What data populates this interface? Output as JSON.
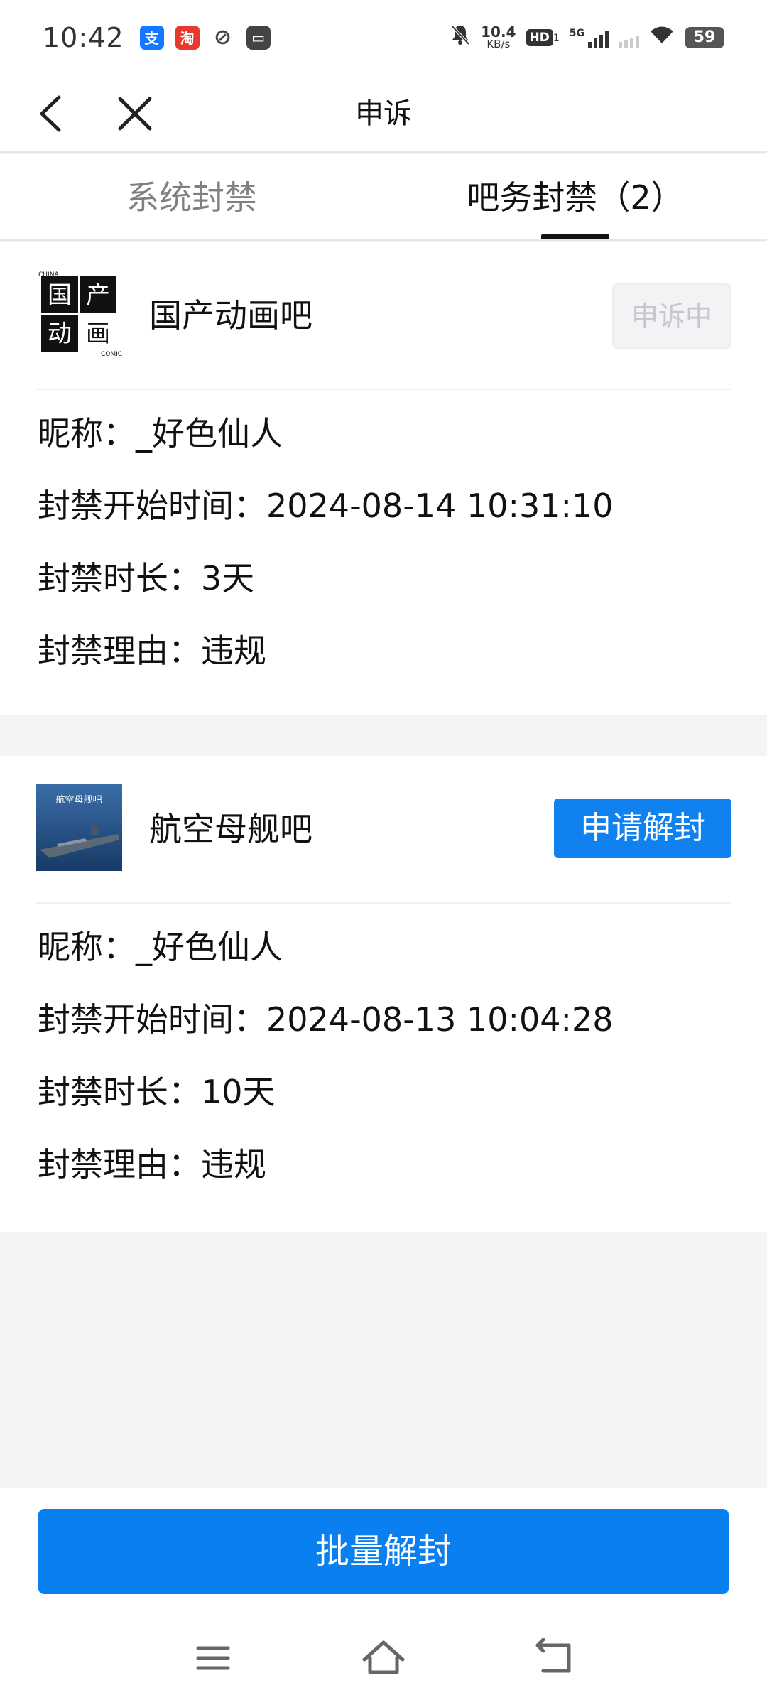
{
  "status_bar": {
    "time": "10:42",
    "speed_value": "10.4",
    "speed_unit": "KB/s",
    "hd_label": "HD",
    "hd_sub": "1",
    "network": "5G",
    "battery": "59"
  },
  "nav": {
    "title": "申诉"
  },
  "tabs": [
    {
      "label": "系统封禁",
      "active": false
    },
    {
      "label": "吧务封禁（2）",
      "active": true
    }
  ],
  "bans": [
    {
      "forum": "国产动画吧",
      "avatar_text": {
        "tl": "国",
        "tr": "产",
        "bl": "动",
        "br": "画",
        "top": "CHINA",
        "bottom": "COMIC"
      },
      "action": "申诉中",
      "nickname": "昵称：_好色仙人",
      "start_time": "封禁开始时间：2024-08-14 10:31:10",
      "duration": "封禁时长：3天",
      "reason": "封禁理由：违规"
    },
    {
      "forum": "航空母舰吧",
      "avatar_text": {
        "caption": "航空母舰吧"
      },
      "action": "申请解封",
      "nickname": "昵称：_好色仙人",
      "start_time": "封禁开始时间：2024-08-13 10:04:28",
      "duration": "封禁时长：10天",
      "reason": "封禁理由：违规"
    }
  ],
  "batch_button": "批量解封",
  "colors": {
    "primary_blue": "#0f82ef",
    "disabled_text": "#c6c6cc",
    "background": "#f4f4f6"
  }
}
